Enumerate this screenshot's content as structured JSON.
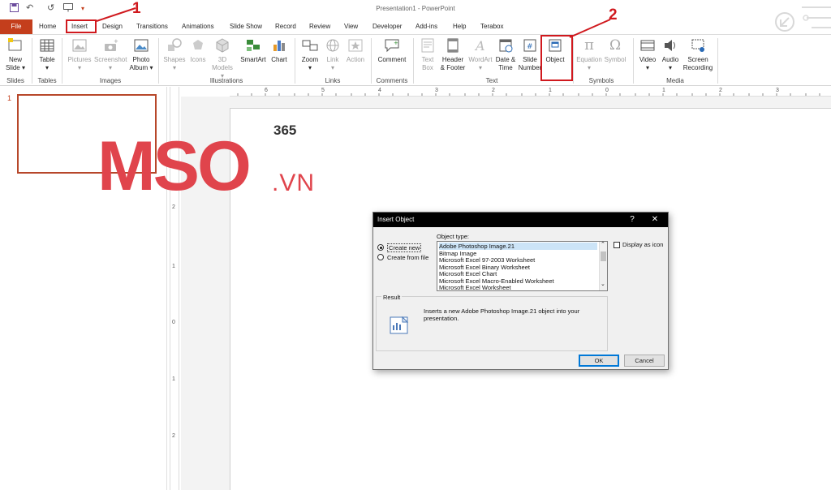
{
  "app": {
    "document_title": "Presentation1  -  PowerPoint"
  },
  "quick_access": {
    "icons": [
      "save-icon",
      "undo-icon",
      "redo-icon",
      "present-icon",
      "customize-icon"
    ]
  },
  "tabs": [
    "File",
    "Home",
    "Insert",
    "Design",
    "Transitions",
    "Animations",
    "Slide Show",
    "Record",
    "Review",
    "View",
    "Developer",
    "Add-ins",
    "Help",
    "Terabox"
  ],
  "active_tab": "Insert",
  "ribbon": {
    "slides": {
      "new_slide": "New",
      "new_slide_2": "Slide",
      "group": "Slides"
    },
    "tables": {
      "table": "Table",
      "group": "Tables"
    },
    "images": {
      "pictures": "Pictures",
      "screenshot": "Screenshot",
      "photo_album": "Photo",
      "photo_album_2": "Album",
      "group": "Images"
    },
    "illustrations": {
      "shapes": "Shapes",
      "icons": "Icons",
      "models": "3D",
      "models_2": "Models",
      "smartart": "SmartArt",
      "chart": "Chart",
      "group": "Illustrations"
    },
    "links": {
      "zoom": "Zoom",
      "link": "Link",
      "action": "Action",
      "group": "Links"
    },
    "comments": {
      "comment": "Comment",
      "group": "Comments"
    },
    "text": {
      "text_box": "Text",
      "text_box_2": "Box",
      "header_footer": "Header",
      "header_footer_2": "& Footer",
      "wordart": "WordArt",
      "date_time": "Date &",
      "date_time_2": "Time",
      "slide_number": "Slide",
      "slide_number_2": "Number",
      "object": "Object",
      "group": "Text"
    },
    "symbols": {
      "equation": "Equation",
      "symbol": "Symbol",
      "group": "Symbols"
    },
    "media": {
      "video": "Video",
      "audio": "Audio",
      "screen_recording": "Screen",
      "screen_recording_2": "Recording",
      "group": "Media"
    }
  },
  "thumbnail": {
    "number": "1"
  },
  "hruler_labels": [
    "6",
    "5",
    "4",
    "3",
    "2",
    "1",
    "0",
    "1",
    "2",
    "3"
  ],
  "vruler_labels": [
    "2",
    "1",
    "0",
    "1",
    "2"
  ],
  "watermark": {
    "text": "MSO",
    "suffix": ".VN",
    "superscript": "365"
  },
  "dialog": {
    "title": "Insert Object",
    "help": "?",
    "close": "✕",
    "create_new": "Create new",
    "create_from_file": "Create from file",
    "object_type_label": "Object type:",
    "object_types": [
      "Adobe Photoshop Image.21",
      "Bitmap Image",
      "Microsoft Excel 97-2003 Worksheet",
      "Microsoft Excel Binary Worksheet",
      "Microsoft Excel Chart",
      "Microsoft Excel Macro-Enabled Worksheet",
      "Microsoft Excel Worksheet"
    ],
    "selected_index": 0,
    "display_as_icon": "Display as icon",
    "result_label": "Result",
    "result_text_1": "Inserts a new Adobe Photoshop Image.21 object into your",
    "result_text_2": "presentation.",
    "ok": "OK",
    "cancel": "Cancel"
  },
  "annotations": {
    "step1": "1",
    "step2": "2"
  },
  "colors": {
    "file_tab": "#c43e1c",
    "annotation": "#d0191e",
    "watermark": "#e0444c"
  }
}
